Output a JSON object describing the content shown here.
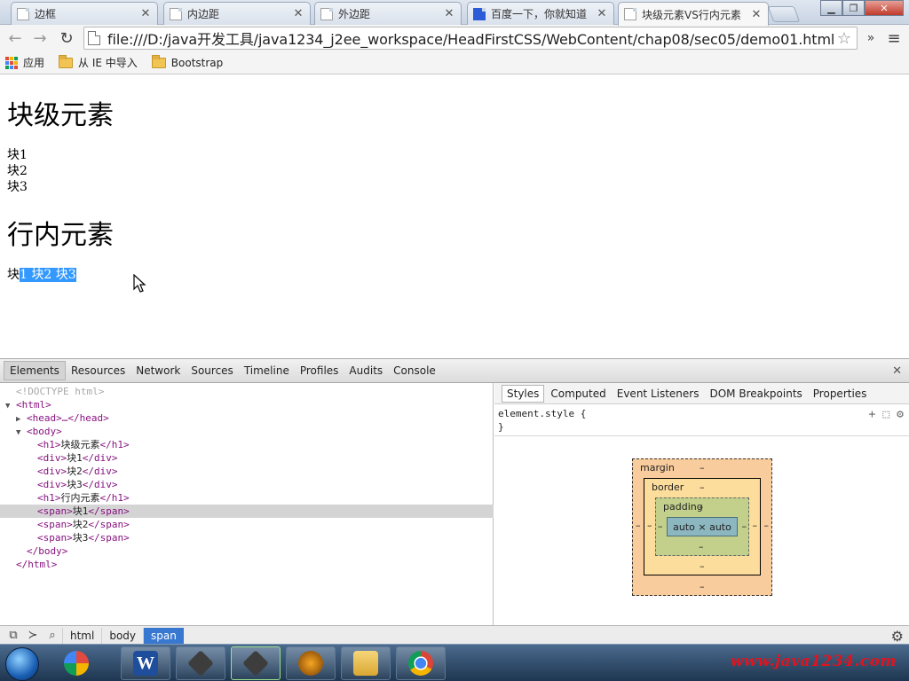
{
  "tabs": [
    {
      "label": "边框",
      "icon": "page-icon"
    },
    {
      "label": "内边距",
      "icon": "page-icon"
    },
    {
      "label": "外边距",
      "icon": "page-icon"
    },
    {
      "label": "百度一下，你就知道",
      "icon": "baidu-paw-icon"
    },
    {
      "label": "块级元素VS行内元素",
      "icon": "page-icon"
    }
  ],
  "address_bar": {
    "url": "file:///D:/java开发工具/java1234_j2ee_workspace/HeadFirstCSS/WebContent/chap08/sec05/demo01.html"
  },
  "bookmarks": [
    {
      "label": "应用",
      "icon": "apps-grid-icon"
    },
    {
      "label": "从 IE 中导入",
      "icon": "folder-icon"
    },
    {
      "label": "Bootstrap",
      "icon": "folder-icon"
    }
  ],
  "page": {
    "heading_block": "块级元素",
    "blocks": [
      "块1",
      "块2",
      "块3"
    ],
    "heading_inline": "行内元素",
    "inline_unselected": "块",
    "inline_selected": "1 块2 块3"
  },
  "devtools": {
    "tabs": [
      "Elements",
      "Resources",
      "Network",
      "Sources",
      "Timeline",
      "Profiles",
      "Audits",
      "Console"
    ],
    "tree": [
      {
        "text": "<!DOCTYPE html>"
      },
      {
        "open": "<html>"
      },
      {
        "head": "<head>…</head>"
      },
      {
        "open": "<body>"
      },
      {
        "h1": "块级元素"
      },
      {
        "d1": "块1"
      },
      {
        "d2": "块2"
      },
      {
        "d3": "块3"
      },
      {
        "h1b": "行内元素"
      },
      {
        "s1": "块1"
      },
      {
        "s2": "块2"
      },
      {
        "s3": "块3"
      },
      {
        "close_body": "</body>"
      },
      {
        "close_html": "</html>"
      }
    ],
    "styles_tabs": [
      "Styles",
      "Computed",
      "Event Listeners",
      "DOM Breakpoints",
      "Properties"
    ],
    "element_style_open": "element.style {",
    "element_style_close": "}",
    "box_model": {
      "margin_label": "margin",
      "border_label": "border",
      "padding_label": "padding",
      "content": "auto × auto",
      "dash": "–"
    },
    "breadcrumbs": [
      "html",
      "body",
      "span"
    ]
  },
  "taskbar": {
    "apps": [
      "word-icon",
      "java-editor-icon",
      "chrome-app-icon",
      "java-ee-ide-icon",
      "file-explorer-icon",
      "chrome-icon"
    ],
    "watermark": "www.java1234.com"
  },
  "colors": {
    "selection": "#3399ff",
    "tag": "#881280",
    "active_crumb": "#3878d0",
    "watermark": "#e0141e"
  }
}
